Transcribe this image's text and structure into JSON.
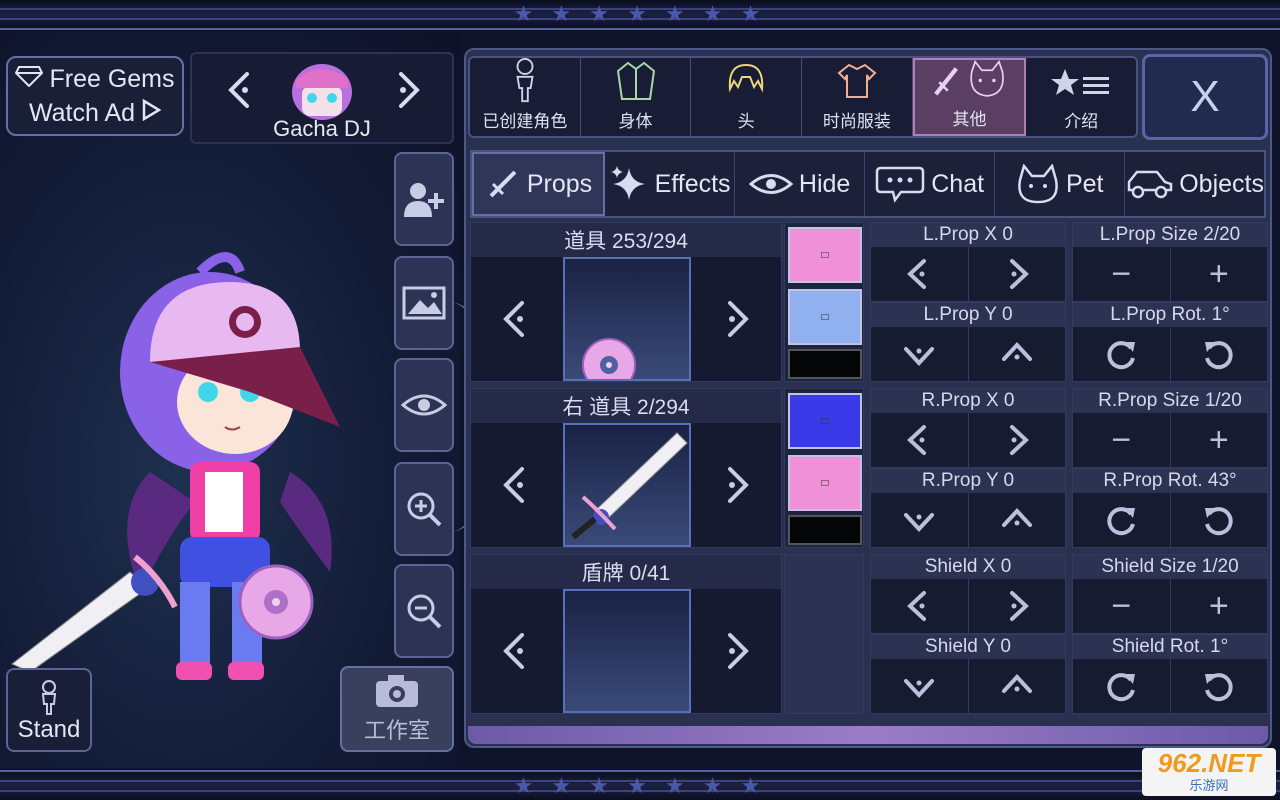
{
  "banner": {
    "stars": "★ ★ ★ ★ ★ ★ ★"
  },
  "gems": {
    "line1": "Free Gems",
    "line2": "Watch Ad"
  },
  "character": {
    "name": "Gacha DJ"
  },
  "left": {
    "stand_label": "Stand",
    "studio_label": "工作室"
  },
  "categories": [
    {
      "label": "已创建角色",
      "icon": "person-icon"
    },
    {
      "label": "身体",
      "icon": "jacket-icon"
    },
    {
      "label": "头",
      "icon": "hair-icon"
    },
    {
      "label": "时尚服装",
      "icon": "shirt-icon"
    },
    {
      "label": "其他",
      "icon": "sword-cat-icon"
    },
    {
      "label": "介绍",
      "icon": "star-list-icon"
    }
  ],
  "close_label": "X",
  "subtabs": [
    {
      "label": "Props"
    },
    {
      "label": "Effects"
    },
    {
      "label": "Hide"
    },
    {
      "label": "Chat"
    },
    {
      "label": "Pet"
    },
    {
      "label": "Objects"
    }
  ],
  "slots": [
    {
      "title": "道具 253/294"
    },
    {
      "title": "右 道具 2/294"
    },
    {
      "title": "盾牌 0/41"
    }
  ],
  "swatches": {
    "left_prop": [
      "#f090d8",
      "#90b0f0",
      "#050608"
    ],
    "right_prop": [
      "#3a3ae8",
      "#f090d8",
      "#050608"
    ]
  },
  "controls": {
    "lprop_x": "L.Prop X 0",
    "lprop_y": "L.Prop Y 0",
    "lprop_size": "L.Prop Size 2/20",
    "lprop_rot": "L.Prop Rot. 1°",
    "rprop_x": "R.Prop X 0",
    "rprop_y": "R.Prop Y 0",
    "rprop_size": "R.Prop Size 1/20",
    "rprop_rot": "R.Prop Rot. 43°",
    "shield_x": "Shield X 0",
    "shield_y": "Shield Y 0",
    "shield_size": "Shield Size 1/20",
    "shield_rot": "Shield Rot. 1°",
    "minus": "−",
    "plus": "+"
  },
  "watermark": {
    "big": "962.NET",
    "small": "乐游网"
  }
}
